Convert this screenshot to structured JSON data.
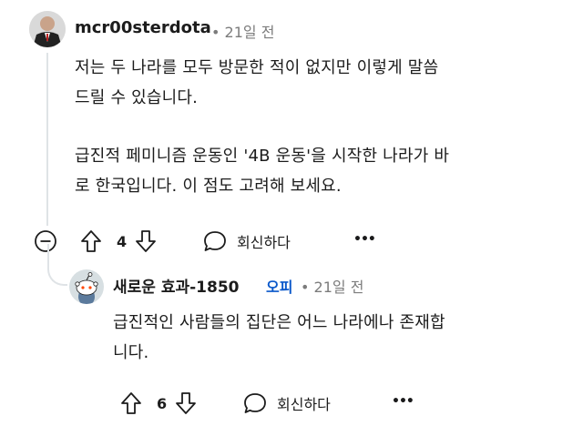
{
  "comment": {
    "username": "mcr00sterdota",
    "time": "21일 전",
    "text_lines": [
      "저는 두 나라를 모두 방문한 적이 없지만 이렇게 말씀",
      "드릴 수 있습니다.",
      "급진적 페미니즘 운동인 '4B 운동'을 시작한 나라가 바",
      "로 한국입니다. 이 점도 고려해 보세요."
    ],
    "upvotes": "4",
    "reply_label": "회신하다",
    "more_label": "•••"
  },
  "reply": {
    "username": "새로운 효과-1850",
    "op_badge": "오피",
    "time": "21일 전",
    "text_lines": [
      "급진적인 사람들의 집단은 어느 나라에나 존재합",
      "니다."
    ],
    "upvotes": "6",
    "reply_label": "회신하다",
    "more_label": "•••"
  },
  "colors": {
    "op": "#0a58ca",
    "meta": "#7c7c7c",
    "reddit_avatar_bg": "#d7dfe2"
  },
  "icons": [
    "avatar-photo",
    "collapse-icon",
    "upvote-icon",
    "downvote-icon",
    "reply-bubble-icon",
    "more-icon",
    "snoo-avatar-icon"
  ]
}
